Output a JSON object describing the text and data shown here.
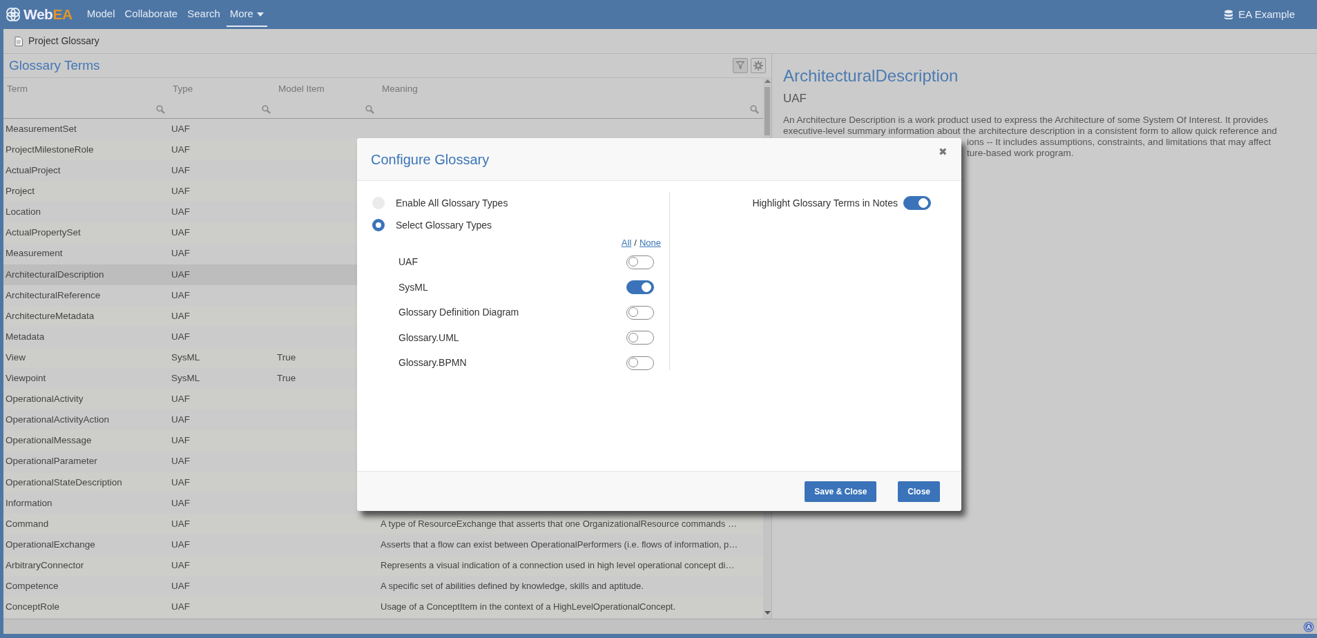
{
  "app": {
    "logo_main": "Web",
    "logo_accent": "EA"
  },
  "nav": [
    {
      "label": "Model",
      "selected": false,
      "caret": false
    },
    {
      "label": "Collaborate",
      "selected": false,
      "caret": false
    },
    {
      "label": "Search",
      "selected": false,
      "caret": false
    },
    {
      "label": "More",
      "selected": true,
      "caret": true
    }
  ],
  "model": "EA Example",
  "breadcrumb": "Project Glossary",
  "glossary": {
    "title": "Glossary Terms",
    "columns": [
      "Term",
      "Type",
      "Model Item",
      "Meaning"
    ],
    "rows": [
      {
        "term": "MeasurementSet",
        "type": "UAF",
        "selected": false
      },
      {
        "term": "ProjectMilestoneRole",
        "type": "UAF",
        "selected": false
      },
      {
        "term": "ActualProject",
        "type": "UAF",
        "selected": false
      },
      {
        "term": "Project",
        "type": "UAF",
        "selected": false
      },
      {
        "term": "Location",
        "type": "UAF",
        "selected": false
      },
      {
        "term": "ActualPropertySet",
        "type": "UAF",
        "selected": false
      },
      {
        "term": "Measurement",
        "type": "UAF",
        "selected": false
      },
      {
        "term": "ArchitecturalDescription",
        "type": "UAF",
        "selected": true
      },
      {
        "term": "ArchitecturalReference",
        "type": "UAF",
        "selected": false
      },
      {
        "term": "ArchitectureMetadata",
        "type": "UAF",
        "selected": false
      },
      {
        "term": "Metadata",
        "type": "UAF",
        "selected": false
      },
      {
        "term": "View",
        "type": "SysML",
        "model_item": "True",
        "selected": false
      },
      {
        "term": "Viewpoint",
        "type": "SysML",
        "model_item": "True",
        "selected": false
      },
      {
        "term": "OperationalActivity",
        "type": "UAF",
        "selected": false
      },
      {
        "term": "OperationalActivityAction",
        "type": "UAF",
        "selected": false
      },
      {
        "term": "OperationalMessage",
        "type": "UAF",
        "selected": false
      },
      {
        "term": "OperationalParameter",
        "type": "UAF",
        "selected": false
      },
      {
        "term": "OperationalStateDescription",
        "type": "UAF",
        "selected": false
      },
      {
        "term": "Information",
        "type": "UAF",
        "selected": false
      },
      {
        "term": "Command",
        "type": "UAF",
        "meaning": "A type of ResourceExchange that asserts that one OrganizationalResource commands …",
        "selected": false
      },
      {
        "term": "OperationalExchange",
        "type": "UAF",
        "meaning": "Asserts that a flow can exist between OperationalPerformers (i.e. flows of information, p…",
        "selected": false
      },
      {
        "term": "ArbitraryConnector",
        "type": "UAF",
        "meaning": "Represents a visual indication of a connection used in high level operational concept di…",
        "selected": false
      },
      {
        "term": "Competence",
        "type": "UAF",
        "meaning": "A specific set of abilities defined by knowledge, skills and aptitude.",
        "selected": false
      },
      {
        "term": "ConceptRole",
        "type": "UAF",
        "meaning": "Usage of a ConceptItem in the context of a HighLevelOperationalConcept.",
        "selected": false
      }
    ]
  },
  "detail": {
    "title": "ArchitecturalDescription",
    "subtitle": "UAF",
    "lines": [
      {
        "text": "An Architecture Description is a work product used to express the Architecture of some System Of Interest. It provides",
        "partial": false
      },
      {
        "text": "executive-level summary information about the architecture description in a consistent form to allow quick reference and",
        "partial": false
      },
      {
        "text": "ions -- It includes assumptions, constraints, and limitations that may affect",
        "partial": true
      },
      {
        "text": "ture-based work program.",
        "partial": true
      }
    ]
  },
  "modal": {
    "title": "Configure Glossary",
    "close": "✖",
    "options": [
      {
        "label": "Enable All Glossary Types",
        "selected": false
      },
      {
        "label": "Select Glossary Types",
        "selected": true
      }
    ],
    "all_link": "All",
    "separator": "/",
    "none_link": "None",
    "types": [
      {
        "label": "UAF",
        "on": false
      },
      {
        "label": "SysML",
        "on": true
      },
      {
        "label": "Glossary Definition Diagram",
        "on": false
      },
      {
        "label": "Glossary.UML",
        "on": false
      },
      {
        "label": "Glossary.BPMN",
        "on": false
      }
    ],
    "highlight": {
      "label": "Highlight Glossary Terms in Notes",
      "on": true
    },
    "buttons": [
      "Save & Close",
      "Close"
    ]
  }
}
